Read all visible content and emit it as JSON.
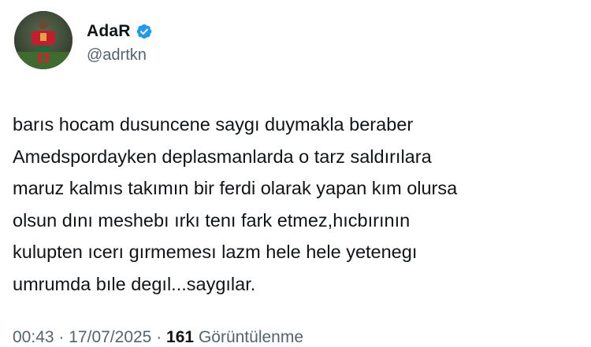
{
  "author": {
    "display_name": "AdaR",
    "handle": "@adrtkn",
    "verified_icon": "verified-badge-icon",
    "verified_color": "#1d9bf0",
    "avatar_icon": "soccer-player-avatar"
  },
  "tweet": {
    "lines": [
      "barıs hocam dusuncene saygı duymakla beraber",
      "Amedspordayken deplasmanlarda o tarz saldırılara",
      "maruz kalmıs takımın bir ferdi  olarak yapan kım olursa",
      "olsun dını meshebı ırkı tenı fark etmez,hıcbırının",
      "kulupten ıcerı gırmemesı lazm hele hele yetenegı",
      "umrumda bıle degıl...saygılar."
    ]
  },
  "meta": {
    "time": "00:43",
    "separator1": "·",
    "date": "17/07/2025",
    "separator2": "·",
    "views_count": "161",
    "views_label": "Görüntülenme"
  }
}
